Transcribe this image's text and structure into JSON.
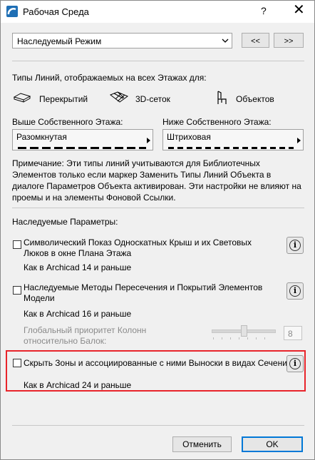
{
  "window": {
    "title": "Рабочая Среда",
    "help": "?",
    "close": "✕"
  },
  "mode": {
    "value": "Наследуемый Режим",
    "prev": "<<",
    "next": ">>"
  },
  "linetypes": {
    "heading": "Типы Линий, отображаемых на всех Этажах для:",
    "slabs": "Перекрытий",
    "mesh": "3D-сеток",
    "objects": "Объектов",
    "above_label": "Выше Собственного Этажа:",
    "above_value": "Разомкнутая",
    "below_label": "Ниже Собственного Этажа:",
    "below_value": "Штриховая",
    "note": "Примечание: Эти типы линий учитываются для Библиотечных Элементов только если маркер Заменить Типы Линий Объекта в диалоге Параметров Объекта активирован. Эти настройки не влияют на проемы и на элементы Фоновой Ссылки."
  },
  "inherited": {
    "heading": "Наследуемые Параметры:",
    "opt1_label": "Символический Показ Односкатных Крыш и их Световых Люков в окне Плана Этажа",
    "opt1_value": "Как в Archicad 14 и раньше",
    "opt2_label": "Наследуемые Методы Пересечения и Покрытий Элементов Модели",
    "opt2_value": "Как в Archicad 16 и раньше",
    "priority_label": "Глобальный приоритет Колонн относительно Балок:",
    "priority_value": "8",
    "opt3_label": "Скрыть Зоны и ассоциированные с ними Выноски в видах Сечений",
    "opt3_value": "Как в Archicad 24 и раньше"
  },
  "info_glyph": "i",
  "buttons": {
    "cancel": "Отменить",
    "ok": "OK"
  },
  "colors": {
    "highlight": "#e8242a",
    "ok_border": "#0078d7"
  }
}
